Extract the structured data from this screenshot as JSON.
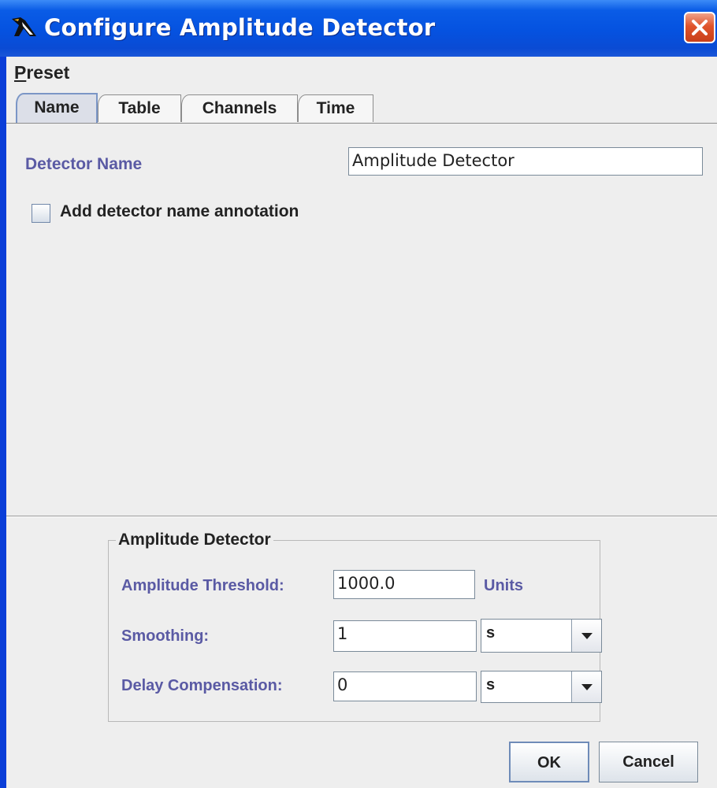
{
  "window": {
    "title": "Configure Amplitude Detector",
    "icon": "penguin-icon",
    "close_icon": "close-icon"
  },
  "menubar": {
    "preset_mnemonic": "P",
    "preset_rest": "reset"
  },
  "tabs": [
    {
      "label": "Name",
      "active": true
    },
    {
      "label": "Table",
      "active": false
    },
    {
      "label": "Channels",
      "active": false
    },
    {
      "label": "Time",
      "active": false
    }
  ],
  "name_tab": {
    "detector_name_label": "Detector Name",
    "detector_name_value": "Amplitude Detector",
    "annotation_checkbox_label": "Add detector name annotation",
    "annotation_checked": false
  },
  "amplitude_group": {
    "title": "Amplitude Detector",
    "threshold_label": "Amplitude Threshold:",
    "threshold_value": "1000.0",
    "threshold_units": "Units",
    "smoothing_label": "Smoothing:",
    "smoothing_value": "1",
    "smoothing_unit": "s",
    "delay_label": "Delay Compensation:",
    "delay_value": "0",
    "delay_unit": "s"
  },
  "buttons": {
    "ok": "OK",
    "cancel": "Cancel"
  },
  "colors": {
    "titlebar": "#0552e0",
    "label_purple": "#5a5aa4",
    "close_button": "#e0532a"
  }
}
